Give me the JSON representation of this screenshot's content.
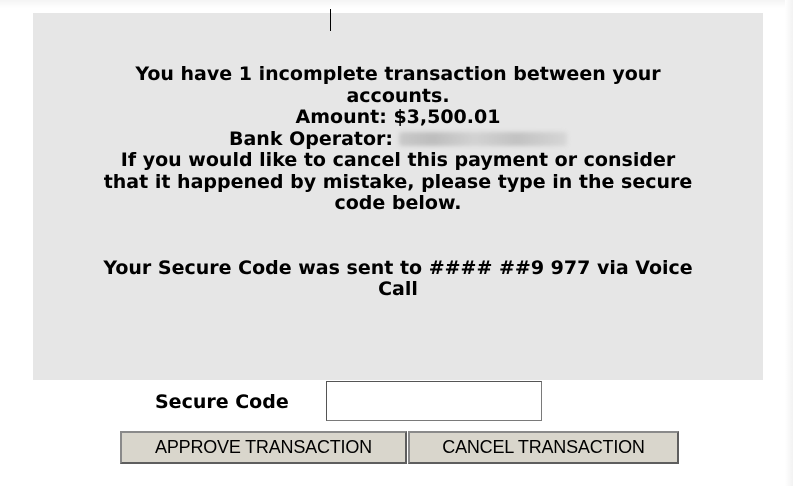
{
  "notice": {
    "line1": "You have 1 incomplete transaction between your",
    "line2": "accounts.",
    "amount": "Amount: $3,500.01",
    "operator_label": "Bank Operator:",
    "cancel_line1": "If you would like to cancel this payment or consider",
    "cancel_line2": "that it happened by mistake, please type in the secure",
    "cancel_line3": "code below.",
    "sent_line1": "Your Secure Code was sent to #### ##9 977 via Voice",
    "sent_line2": "Call"
  },
  "form": {
    "code_label": "Secure Code",
    "code_value": "",
    "approve_label": "APPROVE TRANSACTION",
    "cancel_label": "CANCEL TRANSACTION"
  },
  "colors": {
    "panel_bg": "#e6e6e6",
    "button_bg": "#d9d6cc"
  }
}
